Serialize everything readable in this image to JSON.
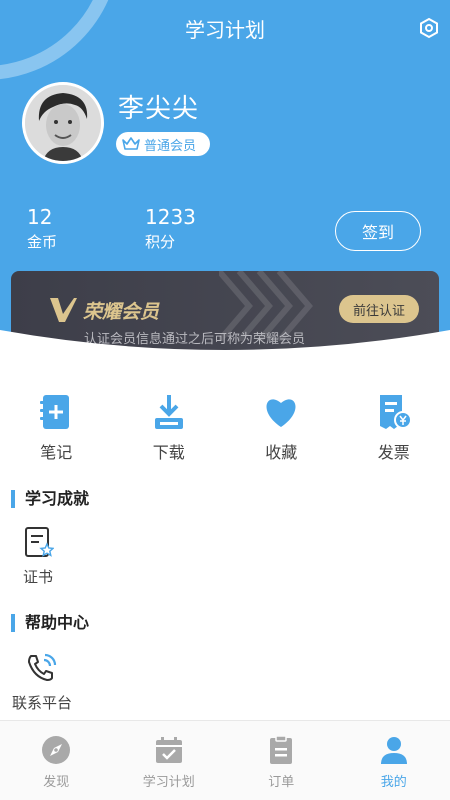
{
  "header": {
    "title": "学习计划",
    "settings_icon": "settings-icon"
  },
  "profile": {
    "name": "李尖尖",
    "member_level": "普通会员"
  },
  "stats": {
    "coins": {
      "value": "12",
      "label": "金币"
    },
    "points": {
      "value": "1233",
      "label": "积分"
    },
    "checkin_label": "签到"
  },
  "vip": {
    "title": "荣耀会员",
    "subtitle": "认证会员信息通过之后可称为荣耀会员",
    "button_label": "前往认证",
    "accent_color": "#dcc58e"
  },
  "quick_actions": [
    {
      "label": "笔记",
      "icon": "note-add-icon"
    },
    {
      "label": "下载",
      "icon": "download-icon"
    },
    {
      "label": "收藏",
      "icon": "heart-icon"
    },
    {
      "label": "发票",
      "icon": "invoice-icon"
    }
  ],
  "sections": {
    "achievements": {
      "title": "学习成就",
      "items": [
        {
          "label": "证书",
          "icon": "certificate-icon"
        }
      ]
    },
    "help": {
      "title": "帮助中心",
      "items": [
        {
          "label": "联系平台",
          "icon": "phone-icon"
        }
      ]
    }
  },
  "tabbar": [
    {
      "label": "发现",
      "icon": "compass-icon",
      "active": false
    },
    {
      "label": "学习计划",
      "icon": "calendar-check-icon",
      "active": false
    },
    {
      "label": "订单",
      "icon": "clipboard-icon",
      "active": false
    },
    {
      "label": "我的",
      "icon": "user-icon",
      "active": true
    }
  ],
  "colors": {
    "primary": "#4aa6e8",
    "tab_inactive": "#9a9a9a"
  }
}
